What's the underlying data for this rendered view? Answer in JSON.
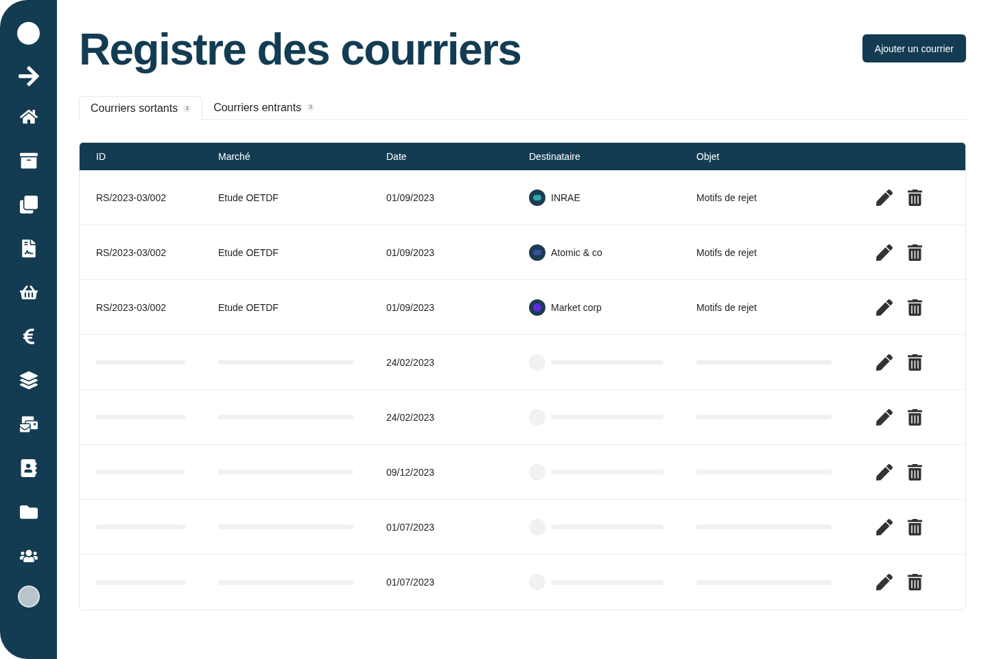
{
  "title": "Registre des courriers",
  "add_button": "Ajouter un courrier",
  "tabs": [
    {
      "label": "Courriers sortants",
      "count": "3",
      "selected": true
    },
    {
      "label": "Courriers entrants",
      "count": "3",
      "selected": false
    }
  ],
  "table": {
    "columns": [
      "ID",
      "Marché",
      "Date",
      "Destinataire",
      "Objet"
    ],
    "rows": [
      {
        "kind": "data",
        "id": "RS/2023-03/002",
        "marche": "Etude OETDF",
        "date": "01/09/2023",
        "destinataire": "INRAE",
        "objet": "Motifs de rejet"
      },
      {
        "kind": "data",
        "id": "RS/2023-03/002",
        "marche": "Etude OETDF",
        "date": "01/09/2023",
        "destinataire": "Atomic & co",
        "objet": "Motifs de rejet"
      },
      {
        "kind": "data",
        "id": "RS/2023-03/002",
        "marche": "Etude OETDF",
        "date": "01/09/2023",
        "destinataire": "Market corp",
        "objet": "Motifs de rejet"
      },
      {
        "kind": "loading",
        "date": "24/02/2023"
      },
      {
        "kind": "loading",
        "date": "24/02/2023"
      },
      {
        "kind": "loading",
        "date": "09/12/2023"
      },
      {
        "kind": "loading",
        "date": "01/07/2023"
      },
      {
        "kind": "loading",
        "date": "01/07/2023"
      }
    ]
  }
}
